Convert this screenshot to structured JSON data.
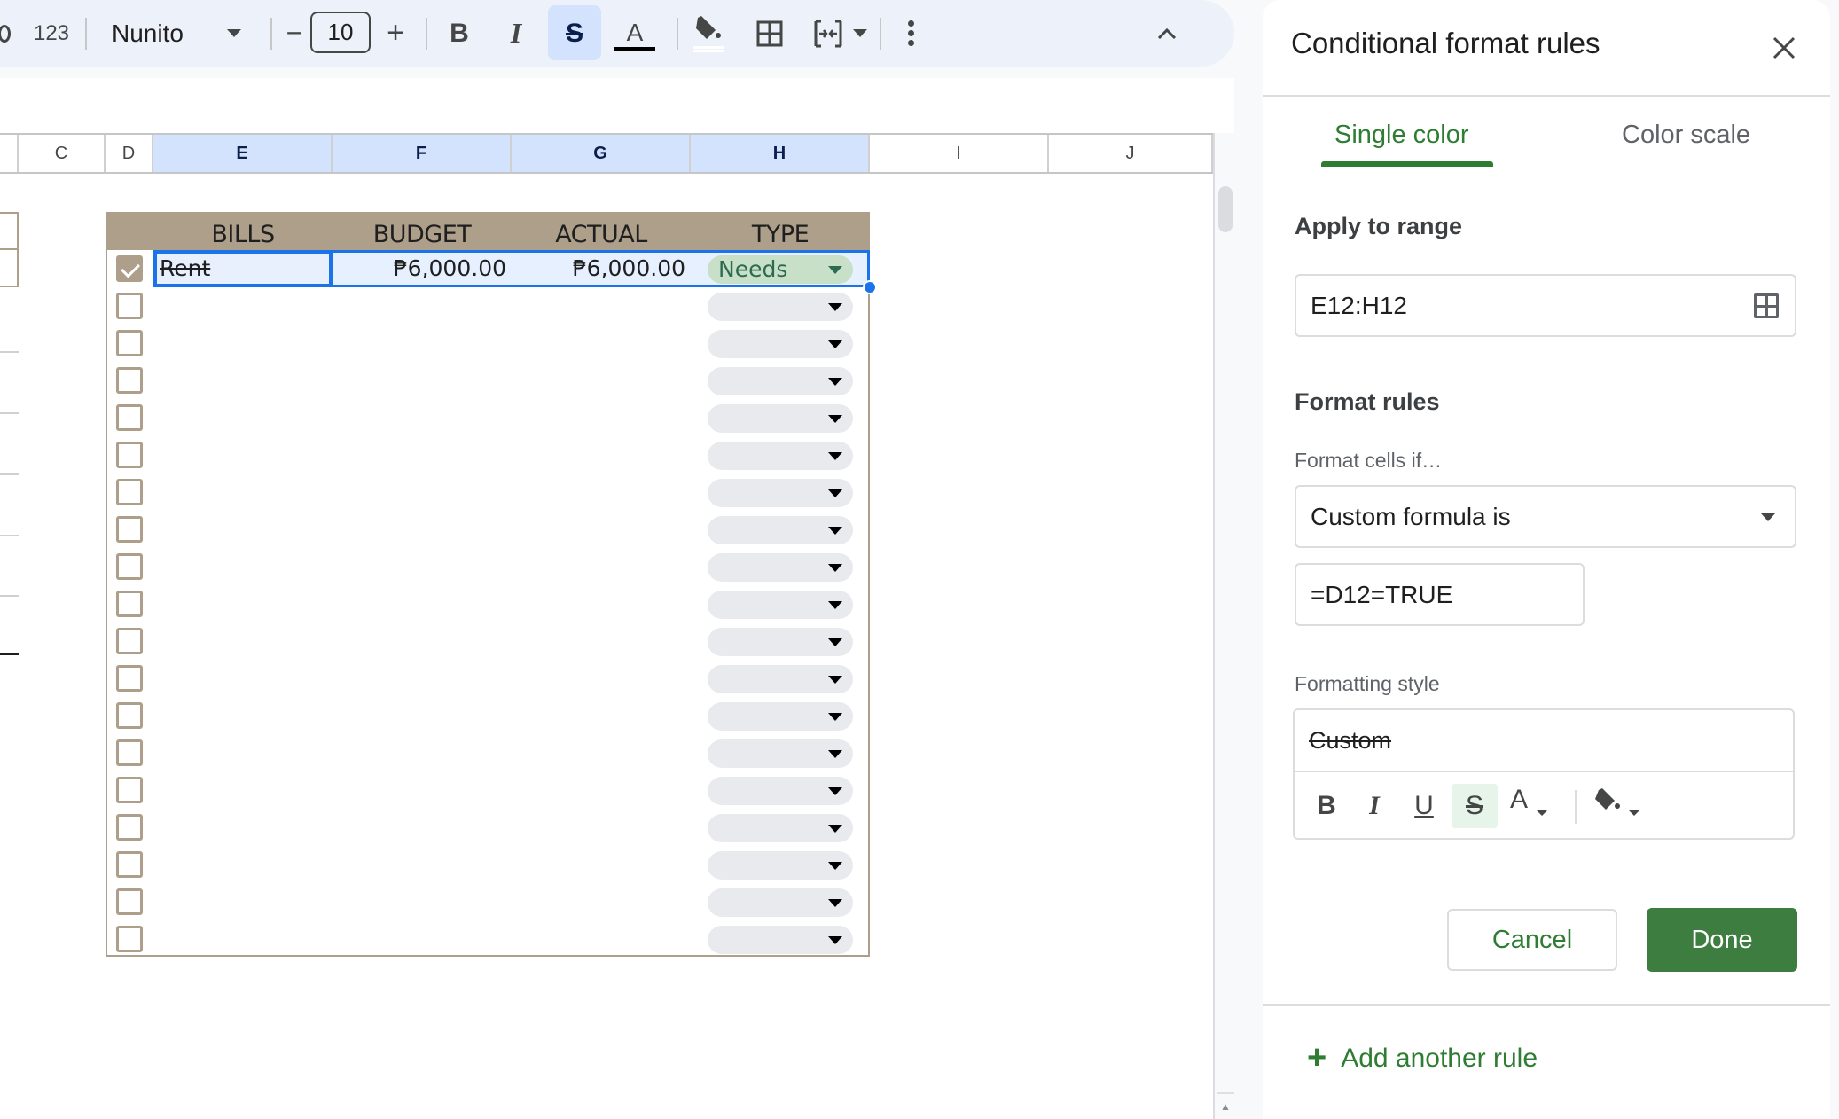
{
  "toolbar": {
    "number_format_label": "123",
    "font_name": "Nunito",
    "font_size": "10",
    "decrease_label": "−",
    "increase_label": "+",
    "bold_label": "B",
    "italic_label": "I",
    "strikethrough_label": "S",
    "text_color_label": "A",
    "more_icon": "more-vert-icon",
    "collapse_icon": "chevron-up-icon"
  },
  "sheet": {
    "column_headers": [
      "C",
      "D",
      "E",
      "F",
      "G",
      "H",
      "I",
      "J"
    ],
    "selected_columns": [
      "E",
      "F",
      "G",
      "H"
    ],
    "table": {
      "headers": [
        "BILLS",
        "BUDGET",
        "ACTUAL",
        "TYPE"
      ],
      "rows": [
        {
          "checked": true,
          "bill": "Rent",
          "budget": "₱6,000.00",
          "actual": "₱6,000.00",
          "type": "Needs"
        }
      ],
      "empty_row_count": 18
    },
    "colors": {
      "header_bg": "#ad9f8a",
      "selection": "#1a73e8",
      "needs_chip": "#c8e0c8"
    }
  },
  "panel": {
    "title": "Conditional format rules",
    "tabs": [
      {
        "label": "Single color",
        "active": true
      },
      {
        "label": "Color scale",
        "active": false
      }
    ],
    "apply_to_range_label": "Apply to range",
    "range_value": "E12:H12",
    "format_rules_label": "Format rules",
    "format_cells_if_label": "Format cells if…",
    "condition_value": "Custom formula is",
    "formula_value": "=D12=TRUE",
    "formatting_style_label": "Formatting style",
    "style_preview": "Custom",
    "style_buttons": {
      "bold": "B",
      "italic": "I",
      "underline": "U",
      "strikethrough": "S",
      "text_color": "A"
    },
    "strikethrough_active": true,
    "cancel_label": "Cancel",
    "done_label": "Done",
    "add_rule_label": "Add another rule",
    "accent_color": "#2e7d32"
  }
}
